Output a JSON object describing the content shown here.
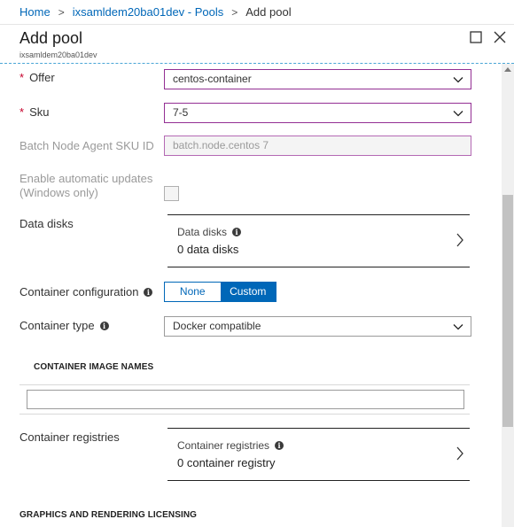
{
  "breadcrumb": {
    "home": "Home",
    "pools": "ixsamldem20ba01dev - Pools",
    "current": "Add pool"
  },
  "blade": {
    "title": "Add pool",
    "subtitle": "ixsamldem20ba01dev"
  },
  "form": {
    "offer": {
      "label": "Offer",
      "value": "centos-container"
    },
    "sku": {
      "label": "Sku",
      "value": "7-5"
    },
    "agent_sku": {
      "label": "Batch Node Agent SKU ID",
      "value": "batch.node.centos 7"
    },
    "auto_updates": {
      "label_line1": "Enable automatic updates",
      "label_line2": "(Windows only)"
    },
    "data_disks": {
      "label": "Data disks",
      "box_title": "Data disks",
      "box_value": "0 data disks"
    },
    "container_config": {
      "label": "Container configuration",
      "option_none": "None",
      "option_custom": "Custom",
      "selected": "Custom"
    },
    "container_type": {
      "label": "Container type",
      "value": "Docker compatible"
    },
    "image_names": {
      "header": "CONTAINER IMAGE NAMES",
      "value": ""
    },
    "registries": {
      "label": "Container registries",
      "box_title": "Container registries",
      "box_value": "0 container registry"
    },
    "graphics_header": "GRAPHICS AND RENDERING LICENSING"
  },
  "icons": {
    "maximize": "maximize-icon",
    "close": "close-icon",
    "chevron": "chevron-down-icon",
    "arrow": "chevron-right-icon",
    "info": "info-icon"
  },
  "colors": {
    "accent": "#0067b8",
    "required": "#c5002b",
    "invalid_border": "#932f93"
  }
}
